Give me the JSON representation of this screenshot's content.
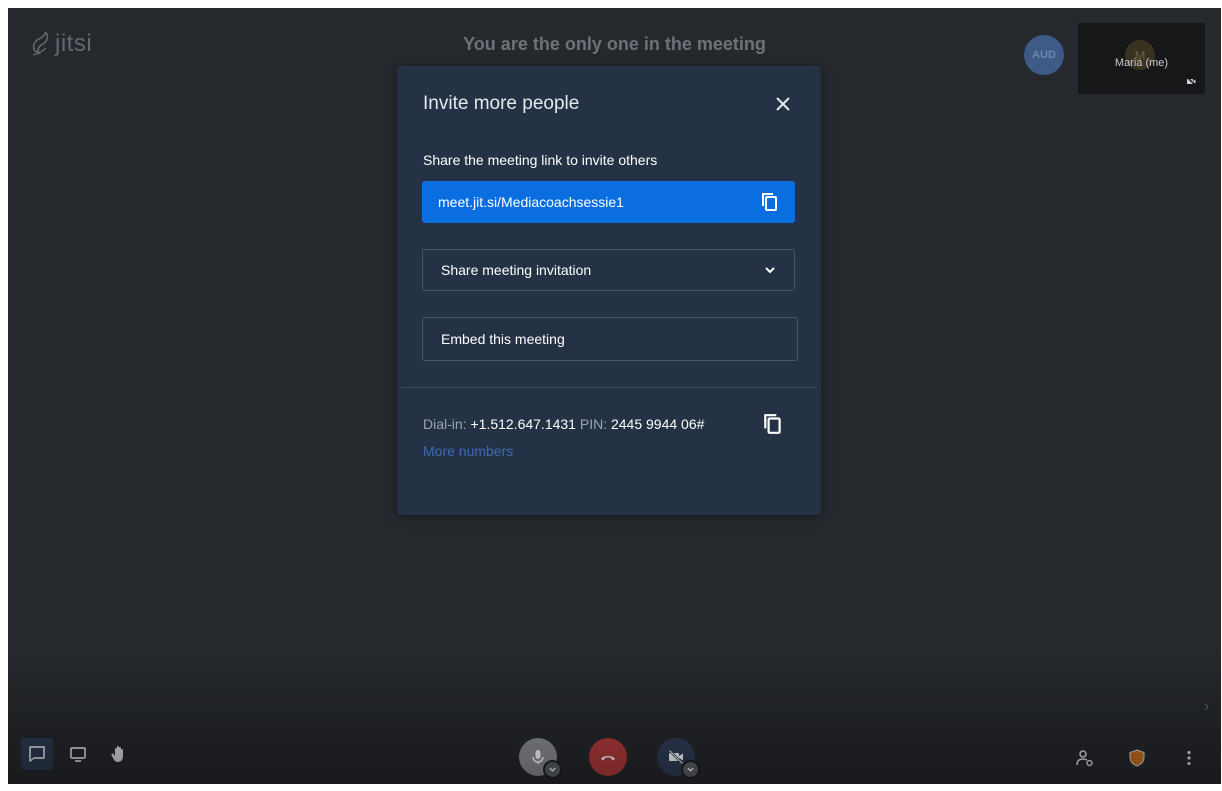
{
  "app": {
    "logo_text": "jitsi"
  },
  "meeting": {
    "status_text": "You are the only one in the meeting",
    "participants": {
      "remote_avatar_label": "AUD",
      "self_name": "Maria (me)",
      "self_initial": "M"
    }
  },
  "invite_dialog": {
    "title": "Invite more people",
    "share_link_label": "Share the meeting link to invite others",
    "meeting_link": "meet.jit.si/Mediacoachsessie1",
    "share_invitation_label": "Share meeting invitation",
    "embed_label": "Embed this meeting",
    "dial_in": {
      "label": "Dial-in:",
      "number": "+1.512.647.1431",
      "pin_label": "PIN:",
      "pin": "2445 9944 06#",
      "more_numbers_label": "More numbers"
    }
  },
  "toolbar": {
    "left": [
      "chat-icon",
      "screen-share-icon",
      "raise-hand-icon"
    ],
    "center": [
      "microphone-icon",
      "hangup-icon",
      "camera-off-icon"
    ],
    "right": [
      "invite-people-icon",
      "security-shield-icon",
      "more-actions-icon"
    ]
  },
  "colors": {
    "background": "#25282c",
    "dialog": "#253246",
    "link_box": "#0b6ee0",
    "hangup": "#b43b3b",
    "security_shield": "#c76f1b",
    "link": "#3d6bb3"
  }
}
